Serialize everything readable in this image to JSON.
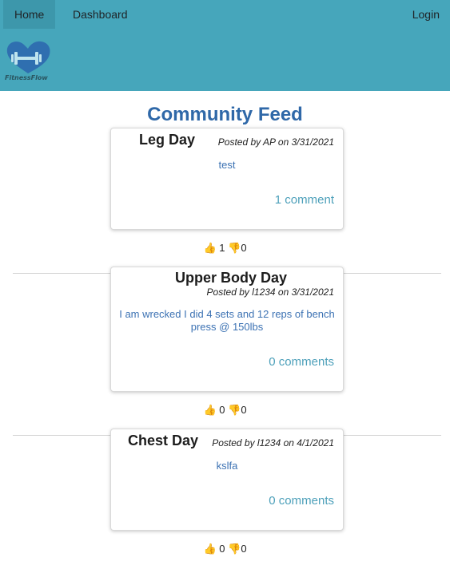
{
  "nav": {
    "home": "Home",
    "dashboard": "Dashboard",
    "login": "Login",
    "logo_text": "FitnessFlow"
  },
  "feed": {
    "title": "Community Feed"
  },
  "posts": [
    {
      "title": "Leg Day",
      "meta": "Posted by AP on 3/31/2021",
      "body": "test",
      "comments": "1 comment",
      "likes": "1",
      "dislikes": "0"
    },
    {
      "title": "Upper Body Day",
      "meta": "Posted by l1234 on 3/31/2021",
      "body": "I am wrecked I did 4 sets and 12 reps of bench press @ 150lbs",
      "comments": "0 comments",
      "likes": "0",
      "dislikes": "0"
    },
    {
      "title": "Chest Day",
      "meta": "Posted by l1234 on 4/1/2021",
      "body": "kslfa",
      "comments": "0 comments",
      "likes": "0",
      "dislikes": "0"
    }
  ],
  "icons": {
    "like": "thumbs-up-icon",
    "dislike": "thumbs-down-icon"
  },
  "colors": {
    "navbar": "#46a6bb",
    "title": "#2f68a8",
    "body_text": "#3c72b3",
    "comments": "#4da0ba"
  }
}
